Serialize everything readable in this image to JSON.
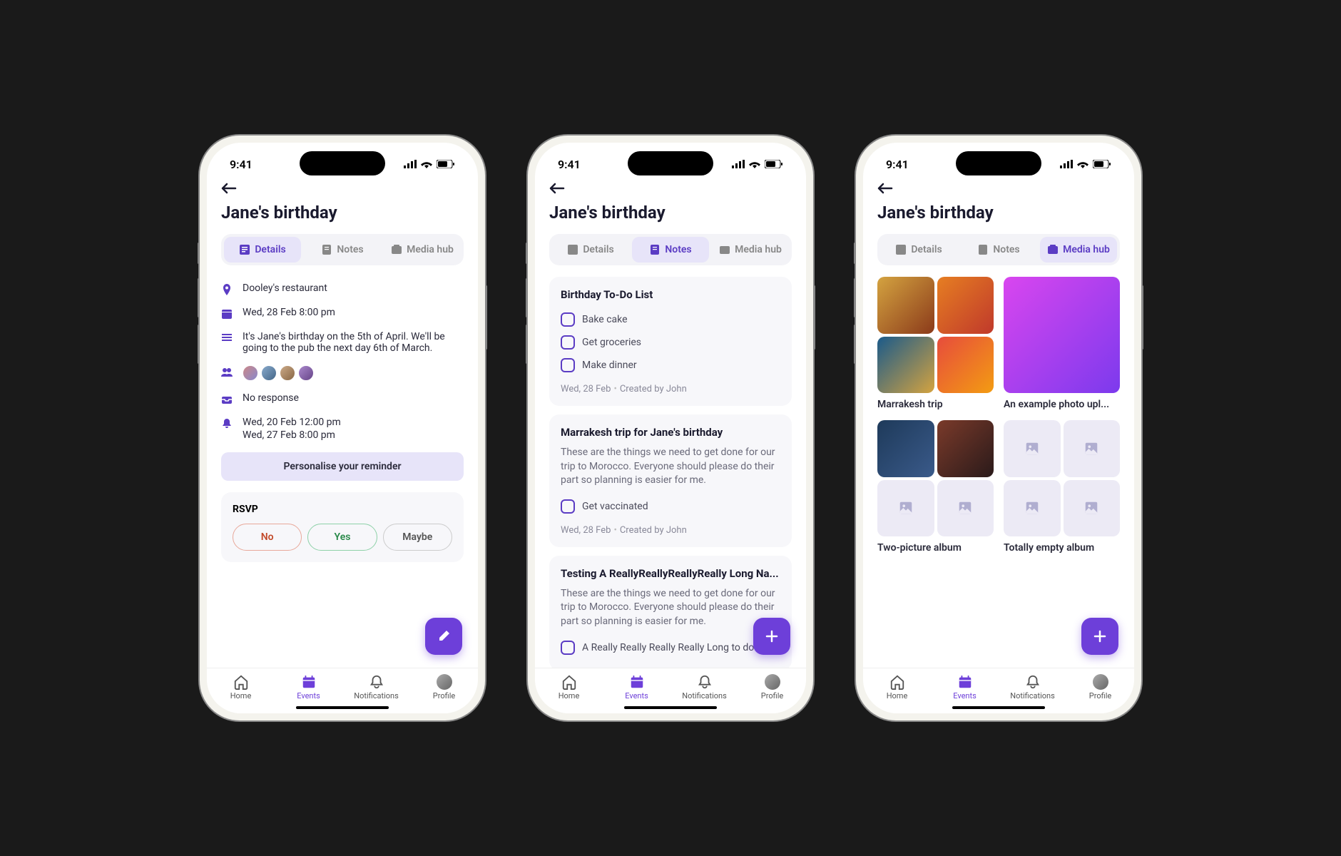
{
  "status": {
    "time": "9:41"
  },
  "title": "Jane's birthday",
  "tabs": {
    "details": "Details",
    "notes": "Notes",
    "media": "Media hub"
  },
  "details": {
    "location": "Dooley's restaurant",
    "datetime": "Wed, 28 Feb   8:00 pm",
    "description": "It's Jane's birthday on the 5th of April. We'll be going to the pub the next day 6th of March.",
    "rsvp_status": "No response",
    "reminder1": "Wed, 20 Feb   12:00 pm",
    "reminder2": "Wed, 27 Feb   8:00 pm",
    "personalise": "Personalise your reminder"
  },
  "rsvp": {
    "heading": "RSVP",
    "no": "No",
    "yes": "Yes",
    "maybe": "Maybe"
  },
  "notes": [
    {
      "title": "Birthday To-Do List",
      "desc": "",
      "todos": [
        "Bake cake",
        "Get groceries",
        "Make dinner"
      ],
      "date": "Wed, 28 Feb",
      "by": "Created by John"
    },
    {
      "title": "Marrakesh trip for Jane's birthday",
      "desc": "These are the things we need to get done for our trip to Morocco. Everyone should please do their part so planning is easier for me.",
      "todos": [
        "Get vaccinated"
      ],
      "date": "Wed, 28 Feb",
      "by": "Created by John"
    },
    {
      "title": "Testing A ReallyReallyReallyReally Long Na...",
      "desc": "These are the things we need to get done for our trip to Morocco. Everyone should please do their part so planning is easier for me.",
      "todos": [
        "A Really Really Really Really Long to do ..."
      ],
      "date": "",
      "by": ""
    }
  ],
  "albums": [
    {
      "title": "Marrakesh trip"
    },
    {
      "title": "An example photo upl..."
    },
    {
      "title": "Two-picture album"
    },
    {
      "title": "Totally empty album"
    }
  ],
  "nav": {
    "home": "Home",
    "events": "Events",
    "notifications": "Notifications",
    "profile": "Profile"
  }
}
